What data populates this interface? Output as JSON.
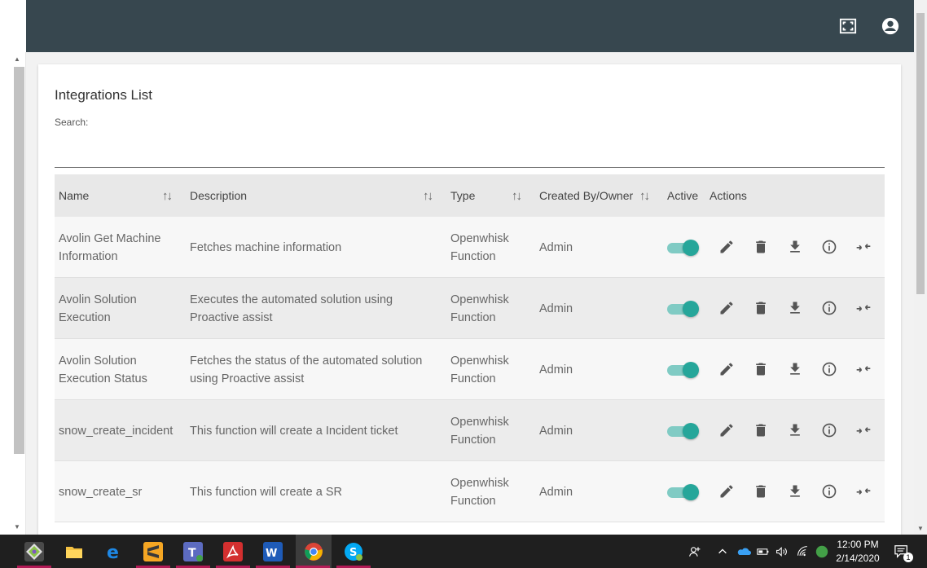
{
  "header": {
    "fullscreen_icon": "fullscreen-icon",
    "account_icon": "account-circle-icon"
  },
  "page": {
    "title": "Integrations List",
    "search_label": "Search:",
    "search_value": ""
  },
  "table": {
    "headers": {
      "name": "Name",
      "description": "Description",
      "type": "Type",
      "created_by": "Created By/Owner",
      "active": "Active",
      "actions": "Actions"
    },
    "sort_glyph": "↑↓",
    "rows": [
      {
        "name": "Avolin Get Machine Information",
        "description": "Fetches machine information",
        "type": "Openwhisk Function",
        "created_by": "Admin",
        "active": true
      },
      {
        "name": "Avolin Solution Execution",
        "description": "Executes the automated solution using Proactive assist",
        "type": "Openwhisk Function",
        "created_by": "Admin",
        "active": true
      },
      {
        "name": "Avolin Solution Execution Status",
        "description": "Fetches the status of the automated solution using Proactive assist",
        "type": "Openwhisk Function",
        "created_by": "Admin",
        "active": true
      },
      {
        "name": "snow_create_incident",
        "description": "This function will create a Incident ticket",
        "type": "Openwhisk Function",
        "created_by": "Admin",
        "active": true
      },
      {
        "name": "snow_create_sr",
        "description": "This function will create a SR",
        "type": "Openwhisk Function",
        "created_by": "Admin",
        "active": true
      }
    ],
    "action_icons": [
      "edit-icon",
      "delete-icon",
      "download-icon",
      "info-icon",
      "link-icon"
    ]
  },
  "colors": {
    "header_bg": "#37474f",
    "toggle_on": "#26a69a",
    "toggle_track": "#80cbc4"
  },
  "taskbar": {
    "apps": [
      "git-icon",
      "file-explorer-icon",
      "edge-icon",
      "sublime-icon",
      "teams-icon",
      "acrobat-icon",
      "word-icon",
      "chrome-icon",
      "skype-icon"
    ],
    "time": "12:00 PM",
    "date": "2/14/2020",
    "notification_count": "1"
  }
}
